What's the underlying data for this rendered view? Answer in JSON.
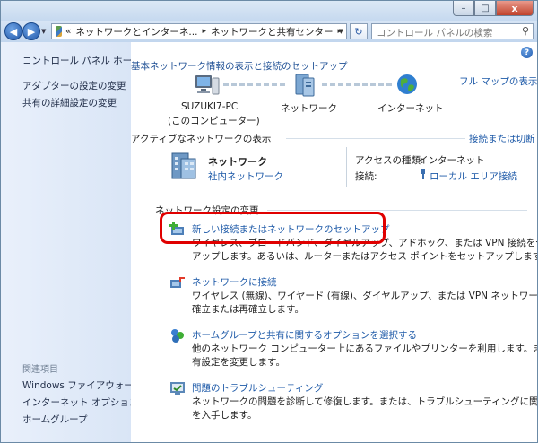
{
  "window": {
    "minimize": "–",
    "maximize": "□",
    "close": "x"
  },
  "nav": {
    "address_prefix": "«",
    "address_parts": [
      "ネットワークとインターネ...",
      "ネットワークと共有センター"
    ],
    "search_placeholder": "コントロール パネルの検索"
  },
  "sidebar": {
    "items": [
      "コントロール パネル ホーム",
      "アダプターの設定の変更",
      "共有の詳細設定の変更"
    ],
    "related_header": "関連項目",
    "related": [
      "Windows ファイアウォール",
      "インターネット オプション",
      "ホームグループ"
    ]
  },
  "main": {
    "title": "基本ネットワーク情報の表示と接続のセットアップ",
    "full_map": "フル マップの表示",
    "map": {
      "computer_name": "SUZUKI7-PC",
      "computer_sub": "(このコンピューター)",
      "network": "ネットワーク",
      "internet": "インターネット"
    },
    "active_header": "アクティブなネットワークの表示",
    "connect_disconnect": "接続または切断",
    "active": {
      "name": "ネットワーク",
      "type": "社内ネットワーク",
      "access_label": "アクセスの種類:",
      "access_value": "インターネット",
      "conn_label": "接続:",
      "conn_value": "ローカル エリア接続"
    },
    "change_header": "ネットワーク設定の変更",
    "tasks": [
      {
        "title": "新しい接続またはネットワークのセットアップ",
        "desc1": "ワイヤレス、ブロードバンド、ダイヤルアップ、アドホック、または VPN 接続をセット",
        "desc2": "アップします。あるいは、ルーターまたはアクセス ポイントをセットアップします。"
      },
      {
        "title": "ネットワークに接続",
        "desc1": "ワイヤレス (無線)、ワイヤード (有線)、ダイヤルアップ、または VPN ネットワーク接続を",
        "desc2": "確立または再確立します。"
      },
      {
        "title": "ホームグループと共有に関するオプションを選択する",
        "desc1": "他のネットワーク コンピューター上にあるファイルやプリンターを利用します。または、共",
        "desc2": "有設定を変更します。"
      },
      {
        "title": "問題のトラブルシューティング",
        "desc1": "ネットワークの問題を診断して修復します。または、トラブルシューティングに関する情報",
        "desc2": "を入手します。"
      }
    ]
  }
}
